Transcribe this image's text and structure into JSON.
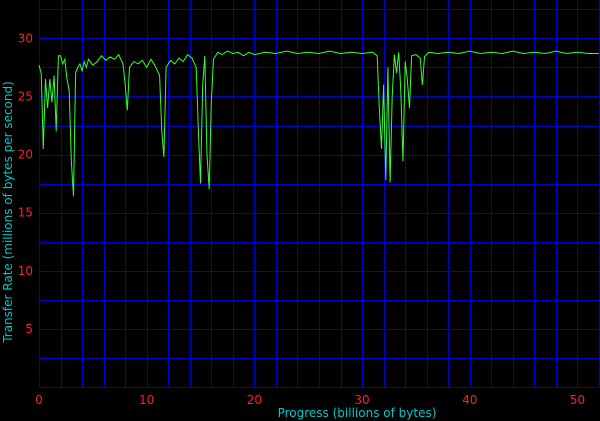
{
  "chart_data": {
    "type": "line",
    "title": "",
    "xlabel": "Progress (billions of bytes)",
    "ylabel": "Transfer Rate (millions of bytes per second)",
    "xlim": [
      0,
      52
    ],
    "ylim": [
      0,
      33.3
    ],
    "xticks": [
      0,
      10,
      20,
      30,
      40,
      50
    ],
    "yticks": [
      5,
      10,
      15,
      20,
      25,
      30
    ],
    "grid": true,
    "colors": {
      "background": "#000000",
      "grid": "#0000c8",
      "series": "#33ff33",
      "tick_labels": "#ff2020",
      "axis_labels": "#00c8c8"
    },
    "series": [
      {
        "values": [
          [
            0.0,
            27.7
          ],
          [
            0.2,
            27.0
          ],
          [
            0.4,
            20.5
          ],
          [
            0.6,
            26.5
          ],
          [
            0.8,
            24.0
          ],
          [
            1.0,
            26.5
          ],
          [
            1.2,
            24.5
          ],
          [
            1.4,
            26.8
          ],
          [
            1.6,
            22.0
          ],
          [
            1.8,
            28.5
          ],
          [
            2.0,
            28.5
          ],
          [
            2.2,
            27.8
          ],
          [
            2.4,
            28.2
          ],
          [
            2.6,
            26.5
          ],
          [
            2.8,
            25.5
          ],
          [
            3.0,
            19.5
          ],
          [
            3.2,
            16.4
          ],
          [
            3.4,
            27.0
          ],
          [
            3.6,
            27.5
          ],
          [
            3.8,
            27.8
          ],
          [
            4.0,
            27.2
          ],
          [
            4.2,
            28.0
          ],
          [
            4.4,
            27.5
          ],
          [
            4.6,
            28.2
          ],
          [
            5.0,
            27.7
          ],
          [
            5.4,
            28.0
          ],
          [
            5.8,
            28.5
          ],
          [
            6.2,
            28.1
          ],
          [
            6.6,
            28.4
          ],
          [
            7.0,
            28.2
          ],
          [
            7.4,
            28.6
          ],
          [
            7.8,
            27.8
          ],
          [
            8.0,
            26.0
          ],
          [
            8.2,
            23.8
          ],
          [
            8.4,
            27.5
          ],
          [
            8.8,
            28.0
          ],
          [
            9.2,
            27.8
          ],
          [
            9.6,
            28.1
          ],
          [
            10.0,
            27.5
          ],
          [
            10.4,
            28.2
          ],
          [
            10.8,
            27.6
          ],
          [
            11.2,
            26.8
          ],
          [
            11.4,
            22.0
          ],
          [
            11.6,
            19.8
          ],
          [
            11.8,
            27.5
          ],
          [
            12.2,
            28.1
          ],
          [
            12.6,
            27.8
          ],
          [
            13.0,
            28.3
          ],
          [
            13.4,
            28.0
          ],
          [
            13.8,
            28.6
          ],
          [
            14.2,
            28.3
          ],
          [
            14.6,
            27.5
          ],
          [
            14.8,
            22.0
          ],
          [
            15.0,
            17.5
          ],
          [
            15.2,
            26.0
          ],
          [
            15.4,
            28.5
          ],
          [
            15.6,
            20.0
          ],
          [
            15.8,
            17.0
          ],
          [
            16.0,
            24.5
          ],
          [
            16.2,
            28.2
          ],
          [
            16.6,
            28.8
          ],
          [
            17.0,
            28.6
          ],
          [
            17.5,
            28.9
          ],
          [
            18.0,
            28.7
          ],
          [
            18.5,
            28.8
          ],
          [
            19.0,
            28.5
          ],
          [
            19.5,
            28.8
          ],
          [
            20.0,
            28.6
          ],
          [
            21.0,
            28.8
          ],
          [
            22.0,
            28.7
          ],
          [
            23.0,
            28.9
          ],
          [
            24.0,
            28.7
          ],
          [
            25.0,
            28.8
          ],
          [
            26.0,
            28.7
          ],
          [
            27.0,
            28.9
          ],
          [
            28.0,
            28.7
          ],
          [
            29.0,
            28.8
          ],
          [
            30.0,
            28.7
          ],
          [
            31.0,
            28.8
          ],
          [
            31.4,
            28.5
          ],
          [
            31.6,
            24.0
          ],
          [
            31.8,
            20.5
          ],
          [
            32.0,
            26.0
          ],
          [
            32.2,
            17.8
          ],
          [
            32.4,
            27.5
          ],
          [
            32.6,
            17.6
          ],
          [
            32.8,
            25.0
          ],
          [
            33.0,
            28.6
          ],
          [
            33.2,
            27.0
          ],
          [
            33.4,
            28.8
          ],
          [
            33.6,
            25.5
          ],
          [
            33.8,
            19.4
          ],
          [
            34.0,
            28.0
          ],
          [
            34.2,
            26.5
          ],
          [
            34.4,
            24.0
          ],
          [
            34.6,
            28.5
          ],
          [
            35.0,
            28.6
          ],
          [
            35.4,
            28.3
          ],
          [
            35.6,
            26.0
          ],
          [
            35.8,
            28.4
          ],
          [
            36.2,
            28.8
          ],
          [
            37.0,
            28.7
          ],
          [
            38.0,
            28.8
          ],
          [
            39.0,
            28.7
          ],
          [
            40.0,
            28.9
          ],
          [
            41.0,
            28.7
          ],
          [
            42.0,
            28.8
          ],
          [
            43.0,
            28.7
          ],
          [
            44.0,
            28.9
          ],
          [
            45.0,
            28.7
          ],
          [
            46.0,
            28.8
          ],
          [
            47.0,
            28.7
          ],
          [
            48.0,
            28.9
          ],
          [
            49.0,
            28.7
          ],
          [
            50.0,
            28.8
          ],
          [
            51.0,
            28.7
          ],
          [
            52.0,
            28.7
          ]
        ]
      }
    ]
  }
}
